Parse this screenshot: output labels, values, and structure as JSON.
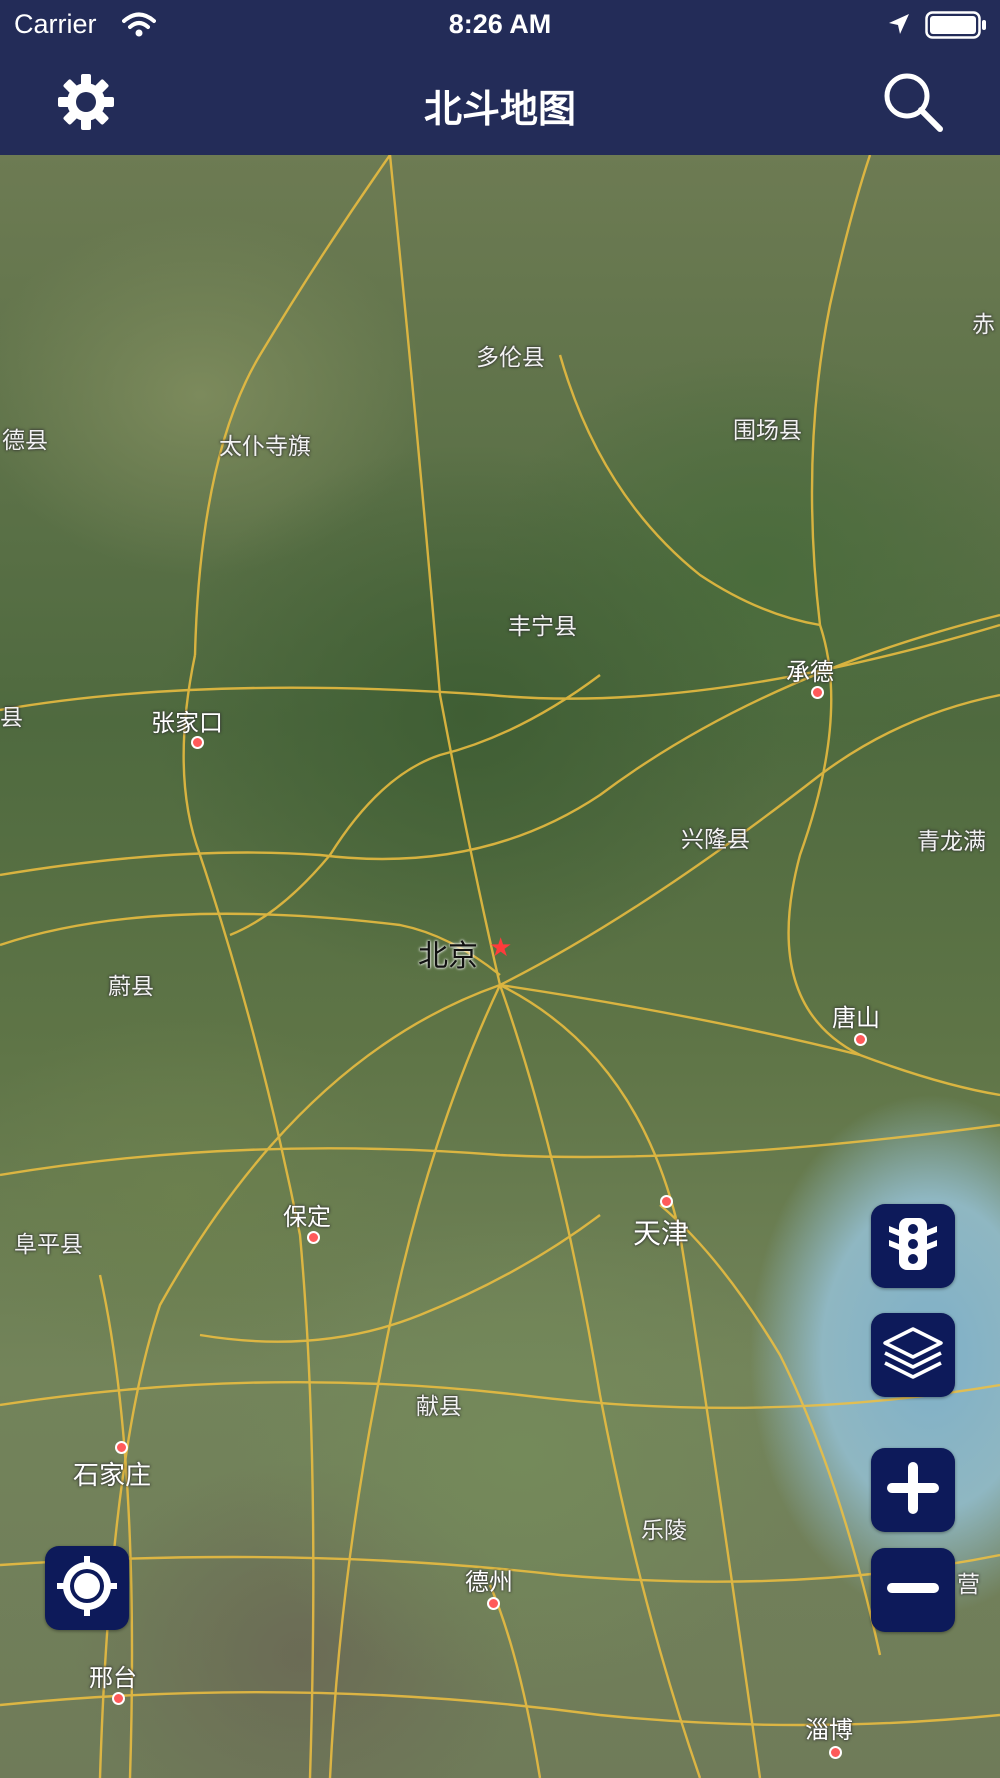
{
  "status_bar": {
    "carrier": "Carrier",
    "time": "8:26 AM"
  },
  "nav": {
    "title": "北斗地图",
    "left_icon": "gear-icon",
    "right_icon": "search-icon"
  },
  "map": {
    "type": "satellite",
    "labels": {
      "duolun": "多伦县",
      "weichang": "围场县",
      "chi": "赤",
      "dexian": "德县",
      "taipusi": "太仆寺旗",
      "fengning": "丰宁县",
      "chengde": "承德",
      "xian_left": "县",
      "zhangjiakou": "张家口",
      "xinglong": "兴隆县",
      "qinglongman": "青龙满",
      "beijing": "北京",
      "yuxian": "蔚县",
      "tangshan": "唐山",
      "baoding": "保定",
      "tianjin": "天津",
      "fuping": "阜平县",
      "xianxian": "献县",
      "shijiazhuang": "石家庄",
      "leling": "乐陵",
      "dezhou": "德州",
      "ying": "营",
      "xingtai": "邢台",
      "zibo": "淄博"
    }
  },
  "controls": {
    "traffic": "traffic-light-icon",
    "layers": "layers-icon",
    "zoom_in": "plus-icon",
    "zoom_out": "minus-icon",
    "locate": "locate-icon"
  },
  "colors": {
    "nav_bg": "#232c58",
    "button_bg": "#0d1a5a",
    "road": "#f0c040",
    "water": "#8fb7c2"
  }
}
